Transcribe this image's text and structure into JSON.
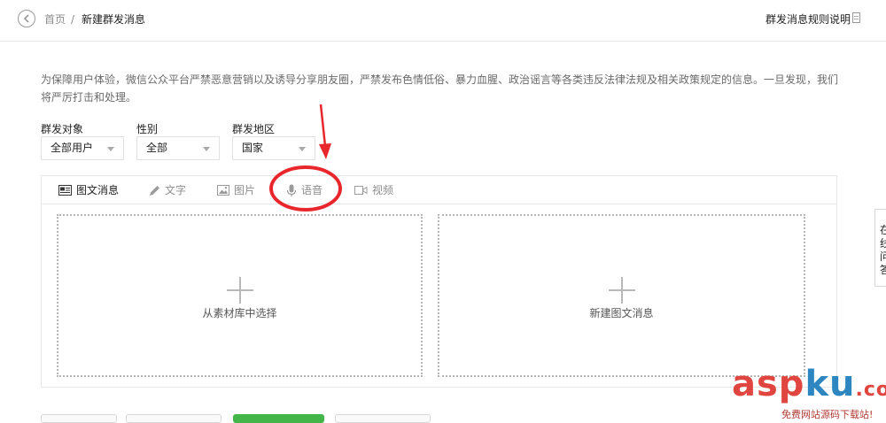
{
  "breadcrumb": {
    "home": "首页",
    "separator": "/",
    "current": "新建群发消息"
  },
  "header": {
    "rules_link": "群发消息规则说明"
  },
  "notice": "为保障用户体验，微信公众平台严禁恶意营销以及诱导分享朋友圈，严禁发布色情低俗、暴力血腥、政治谣言等各类违反法律法规及相关政策规定的信息。一旦发现，我们将严厉打击和处理。",
  "filters": {
    "target": {
      "label": "群发对象",
      "value": "全部用户"
    },
    "gender": {
      "label": "性别",
      "value": "全部"
    },
    "region": {
      "label": "群发地区",
      "value": "国家"
    }
  },
  "tabs": [
    {
      "label": "图文消息",
      "icon": "news-icon",
      "active": true
    },
    {
      "label": "文字",
      "icon": "pen-icon",
      "active": false
    },
    {
      "label": "图片",
      "icon": "image-icon",
      "active": false
    },
    {
      "label": "语音",
      "icon": "microphone-icon",
      "active": false
    },
    {
      "label": "视频",
      "icon": "video-camera-icon",
      "active": false
    }
  ],
  "cards": {
    "from_library": "从素材库中选择",
    "new_news": "新建图文消息"
  },
  "side_tab": [
    "在",
    "线",
    "问",
    "答"
  ],
  "annotation": {
    "color": "#e8262b",
    "highlighted_tab": "语音"
  },
  "watermark": {
    "main_asp": "asp",
    "main_ku": "ku",
    "main_com": ".com",
    "sub": "免费网站源码下载站!"
  },
  "colors": {
    "accent_green": "#44b549",
    "border": "#e4e8eb",
    "annotation_red": "#e8262b"
  }
}
